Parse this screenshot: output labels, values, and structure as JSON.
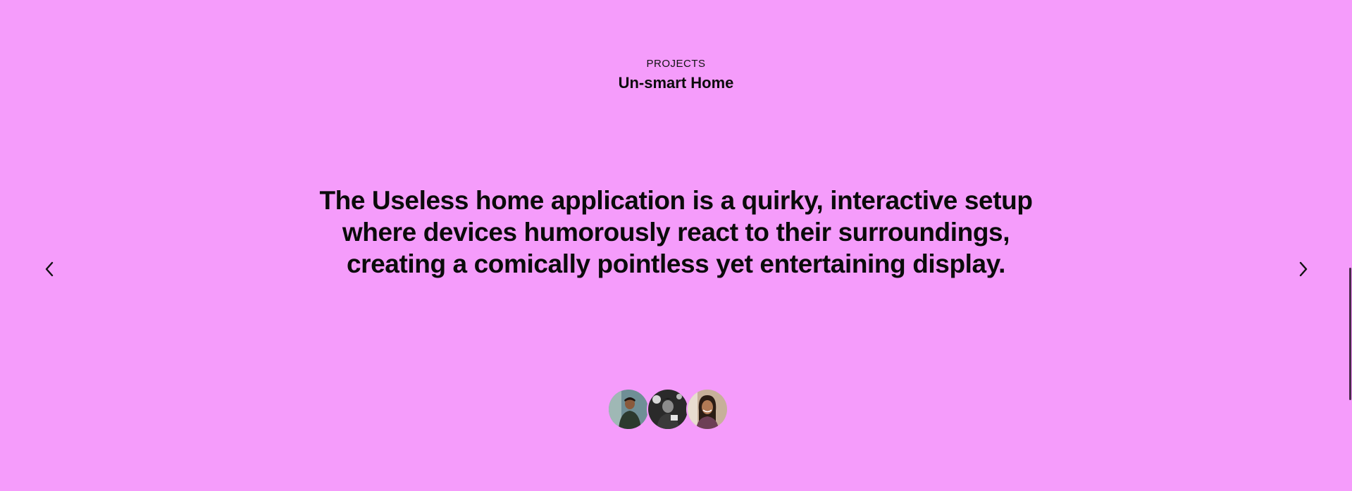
{
  "section": {
    "eyebrow": "PROJECTS",
    "title": "Un-smart Home"
  },
  "slide": {
    "quote_lines": [
      "The Useless home application is a quirky, interactive setup",
      "where devices humorously react to their surroundings,",
      "creating a comically pointless yet entertaining display."
    ]
  },
  "navigation": {
    "prev_icon": "chevron-left-icon",
    "next_icon": "chevron-right-icon"
  },
  "team": {
    "avatars": [
      "team-member-1",
      "team-member-2",
      "team-member-3"
    ]
  },
  "colors": {
    "background": "#f59cfb",
    "text": "#0b0b0b"
  }
}
